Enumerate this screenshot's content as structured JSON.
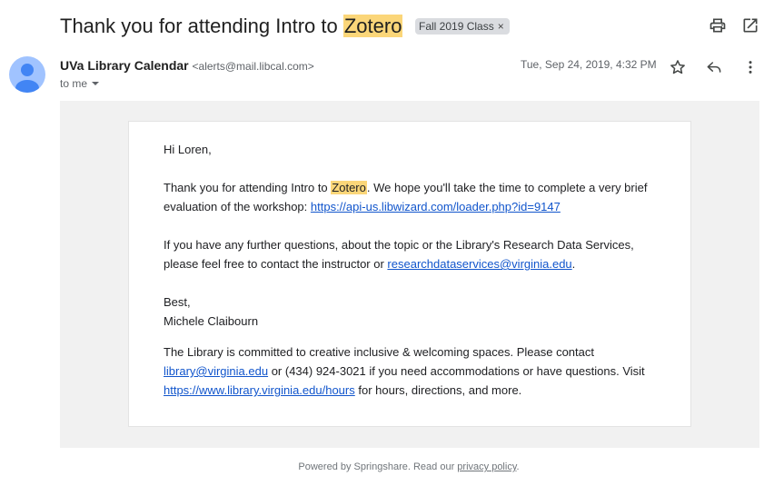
{
  "subject": {
    "prefix": "Thank you for attending Intro to ",
    "highlight": "Zotero",
    "label_chip": "Fall 2019 Class",
    "label_remove": "×"
  },
  "header_icons": {
    "print": "print-icon",
    "open_new": "open-in-new-window-icon"
  },
  "message": {
    "sender_name": "UVa Library Calendar",
    "sender_email": "<alerts@mail.libcal.com>",
    "to_label": "to me",
    "date": "Tue, Sep 24, 2019, 4:32 PM"
  },
  "body": {
    "greeting": "Hi Loren,",
    "p1_before": "Thank you for attending Intro to ",
    "p1_highlight": "Zotero",
    "p1_after": ". We hope you'll take the time to complete a very brief evaluation of the workshop: ",
    "p1_link": "https://api-us.libwizard.com/loader.php?id=9147",
    "p2_text": "If you have any further questions, about the topic or the Library's Research Data Services, please feel free to contact the instructor or ",
    "p2_link": "researchdataservices@virginia.edu",
    "p2_end": ".",
    "signoff": "Best,",
    "signer": "Michele Claibourn",
    "p3_link1": "library@virginia.edu",
    "p3_text_before": "The Library is committed to creative inclusive & welcoming spaces. Please contact ",
    "p3_text_mid": " or (434) 924-3021 if you need accommodations or have questions. Visit ",
    "p3_link2": "https://www.library.virginia.edu/hours",
    "p3_text_after": " for hours, directions, and more."
  },
  "footer": {
    "text": "Powered by Springshare. Read our ",
    "link": "privacy policy",
    "end": "."
  },
  "colors": {
    "highlight": "#fbd679",
    "link": "#1155cc",
    "avatar_bg": "#a0c3ff",
    "avatar_fg": "#4285f4"
  }
}
